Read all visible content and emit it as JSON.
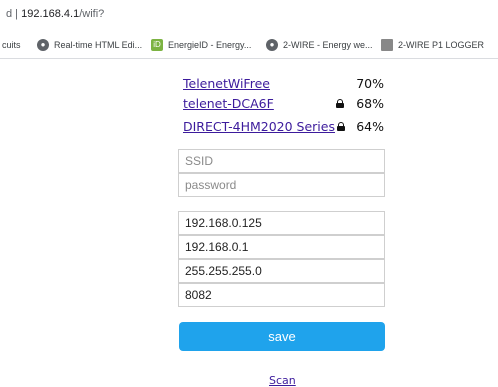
{
  "browser": {
    "url_prefix": "d  |",
    "url_host": "192.168.4.1",
    "url_path": "/wifi?",
    "bookmarks": [
      {
        "label": "cuits",
        "icon": "none"
      },
      {
        "label": "Real-time HTML Edi...",
        "icon": "globe-icon"
      },
      {
        "label": "EnergieID - Energy...",
        "icon": "energieid-icon"
      },
      {
        "label": "2-WIRE - Energy we...",
        "icon": "globe-icon"
      },
      {
        "label": "2-WIRE P1 LOGGER",
        "icon": "grid-icon"
      }
    ]
  },
  "networks": [
    {
      "ssid": "TelenetWiFree",
      "signal": "70%",
      "locked": false
    },
    {
      "ssid": "telenet-DCA6F",
      "signal": "68%",
      "locked": true
    },
    {
      "ssid": "DIRECT-4HM2020 Series",
      "signal": "64%",
      "locked": true
    }
  ],
  "form": {
    "ssid_placeholder": "SSID",
    "password_placeholder": "password",
    "ip": "192.168.0.125",
    "gateway": "192.168.0.1",
    "subnet": "255.255.255.0",
    "port": "8082",
    "save_label": "save",
    "scan_label": "Scan"
  },
  "colors": {
    "link": "#3c1b9c",
    "button": "#1fa3ec"
  }
}
